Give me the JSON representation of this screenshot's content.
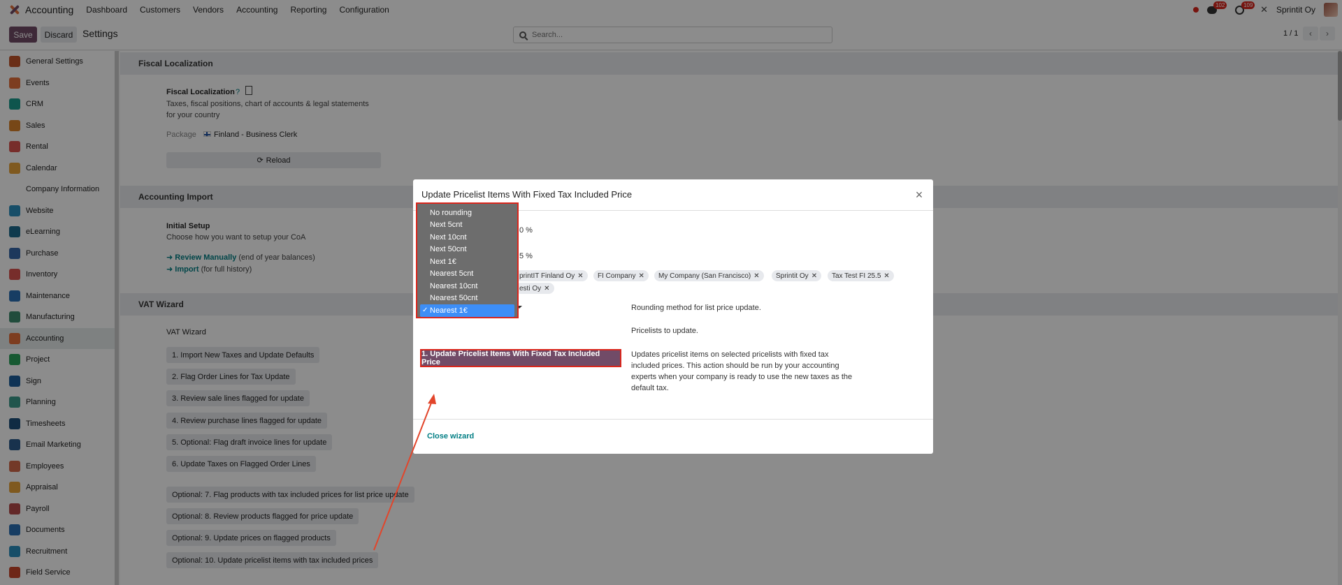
{
  "topnav": {
    "app_name": "Accounting",
    "menu": [
      "Dashboard",
      "Customers",
      "Vendors",
      "Accounting",
      "Reporting",
      "Configuration"
    ],
    "messages_badge": "102",
    "activities_badge": "109",
    "company": "Sprintit Oy"
  },
  "controlbar": {
    "save_label": "Save",
    "discard_label": "Discard",
    "title": "Settings",
    "search_placeholder": "Search...",
    "pager": "1 / 1"
  },
  "sidebar": {
    "items": [
      {
        "label": "General Settings",
        "color": "#c2552a"
      },
      {
        "label": "Events",
        "color": "#e46f3b"
      },
      {
        "label": "CRM",
        "color": "#1a9b8c"
      },
      {
        "label": "Sales",
        "color": "#d9822b"
      },
      {
        "label": "Rental",
        "color": "#d9534f"
      },
      {
        "label": "Calendar",
        "color": "#e8a33a"
      },
      {
        "label": "Company Information",
        "color": "#ffffff"
      },
      {
        "label": "Website",
        "color": "#2a8fbd"
      },
      {
        "label": "eLearning",
        "color": "#1d6b8c"
      },
      {
        "label": "Purchase",
        "color": "#3566a8"
      },
      {
        "label": "Inventory",
        "color": "#d9534f"
      },
      {
        "label": "Maintenance",
        "color": "#2a6fb5"
      },
      {
        "label": "Manufacturing",
        "color": "#3d8b6e"
      },
      {
        "label": "Accounting",
        "color": "#e46f3b"
      },
      {
        "label": "Project",
        "color": "#2aa35b"
      },
      {
        "label": "Sign",
        "color": "#1d5d9b"
      },
      {
        "label": "Planning",
        "color": "#3b9b8a"
      },
      {
        "label": "Timesheets",
        "color": "#1d4f7a"
      },
      {
        "label": "Email Marketing",
        "color": "#2d5b8c"
      },
      {
        "label": "Employees",
        "color": "#d2694a"
      },
      {
        "label": "Appraisal",
        "color": "#e8a33a"
      },
      {
        "label": "Payroll",
        "color": "#b44a4a"
      },
      {
        "label": "Documents",
        "color": "#2a6fb5"
      },
      {
        "label": "Recruitment",
        "color": "#2a8fbd"
      },
      {
        "label": "Field Service",
        "color": "#c8452a"
      }
    ]
  },
  "main": {
    "fiscal": {
      "header": "Fiscal Localization",
      "title": "Fiscal Localization",
      "desc1": "Taxes, fiscal positions, chart of accounts & legal statements",
      "desc2": "for your country",
      "package_label": "Package",
      "package_value": "Finland - Business Clerk",
      "reload": "Reload"
    },
    "import": {
      "header": "Accounting Import",
      "title": "Initial Setup",
      "desc": "Choose how you want to setup your CoA",
      "link1": "Review Manually",
      "link1_note": "(end of year balances)",
      "link2": "Import",
      "link2_note": "(for full history)"
    },
    "vat": {
      "header": "VAT Wizard",
      "title": "VAT Wizard",
      "buttons": [
        "1. Import New Taxes and Update Defaults",
        "2. Flag Order Lines for Tax Update",
        "3. Review sale lines flagged for update",
        "4. Review purchase lines flagged for update",
        "5. Optional: Flag draft invoice lines for update",
        "6. Update Taxes on Flagged Order Lines",
        "Optional: 7. Flag products with tax included prices for list price update",
        "Optional: 8. Review products flagged for price update",
        "Optional: 9. Update prices on flagged products",
        "Optional: 10. Update pricelist items with tax included prices"
      ]
    }
  },
  "modal": {
    "title": "Update Pricelist Items With Fixed Tax Included Price",
    "partial_value_1": "0 %",
    "partial_value_2": "5 %",
    "tags": [
      "printIT Finland Oy",
      "FI Company",
      "My Company (San Francisco)",
      "Sprintit Oy",
      "Tax Test FI 25.5",
      "esti Oy"
    ],
    "rounding_help": "Rounding method for list price update.",
    "pricelists_help": "Pricelists to update.",
    "action_button": "1. Update Pricelist Items With Fixed Tax Included Price",
    "action_help": "Updates pricelist items on selected pricelists with fixed tax included prices. This action should be run by your accounting experts when your company is ready to use the new taxes as the default tax.",
    "close_wizard": "Close wizard"
  },
  "dropdown": {
    "options": [
      "No rounding",
      "Next 5cnt",
      "Next 10cnt",
      "Next 50cnt",
      "Next 1€",
      "Nearest 5cnt",
      "Nearest 10cnt",
      "Nearest 50cnt",
      "Nearest 1€"
    ],
    "selected": "Nearest 1€"
  },
  "colors": {
    "brand": "#714b67",
    "teal": "#017e84",
    "highlight": "#d9261c",
    "selected_option": "#3d8ef7"
  }
}
